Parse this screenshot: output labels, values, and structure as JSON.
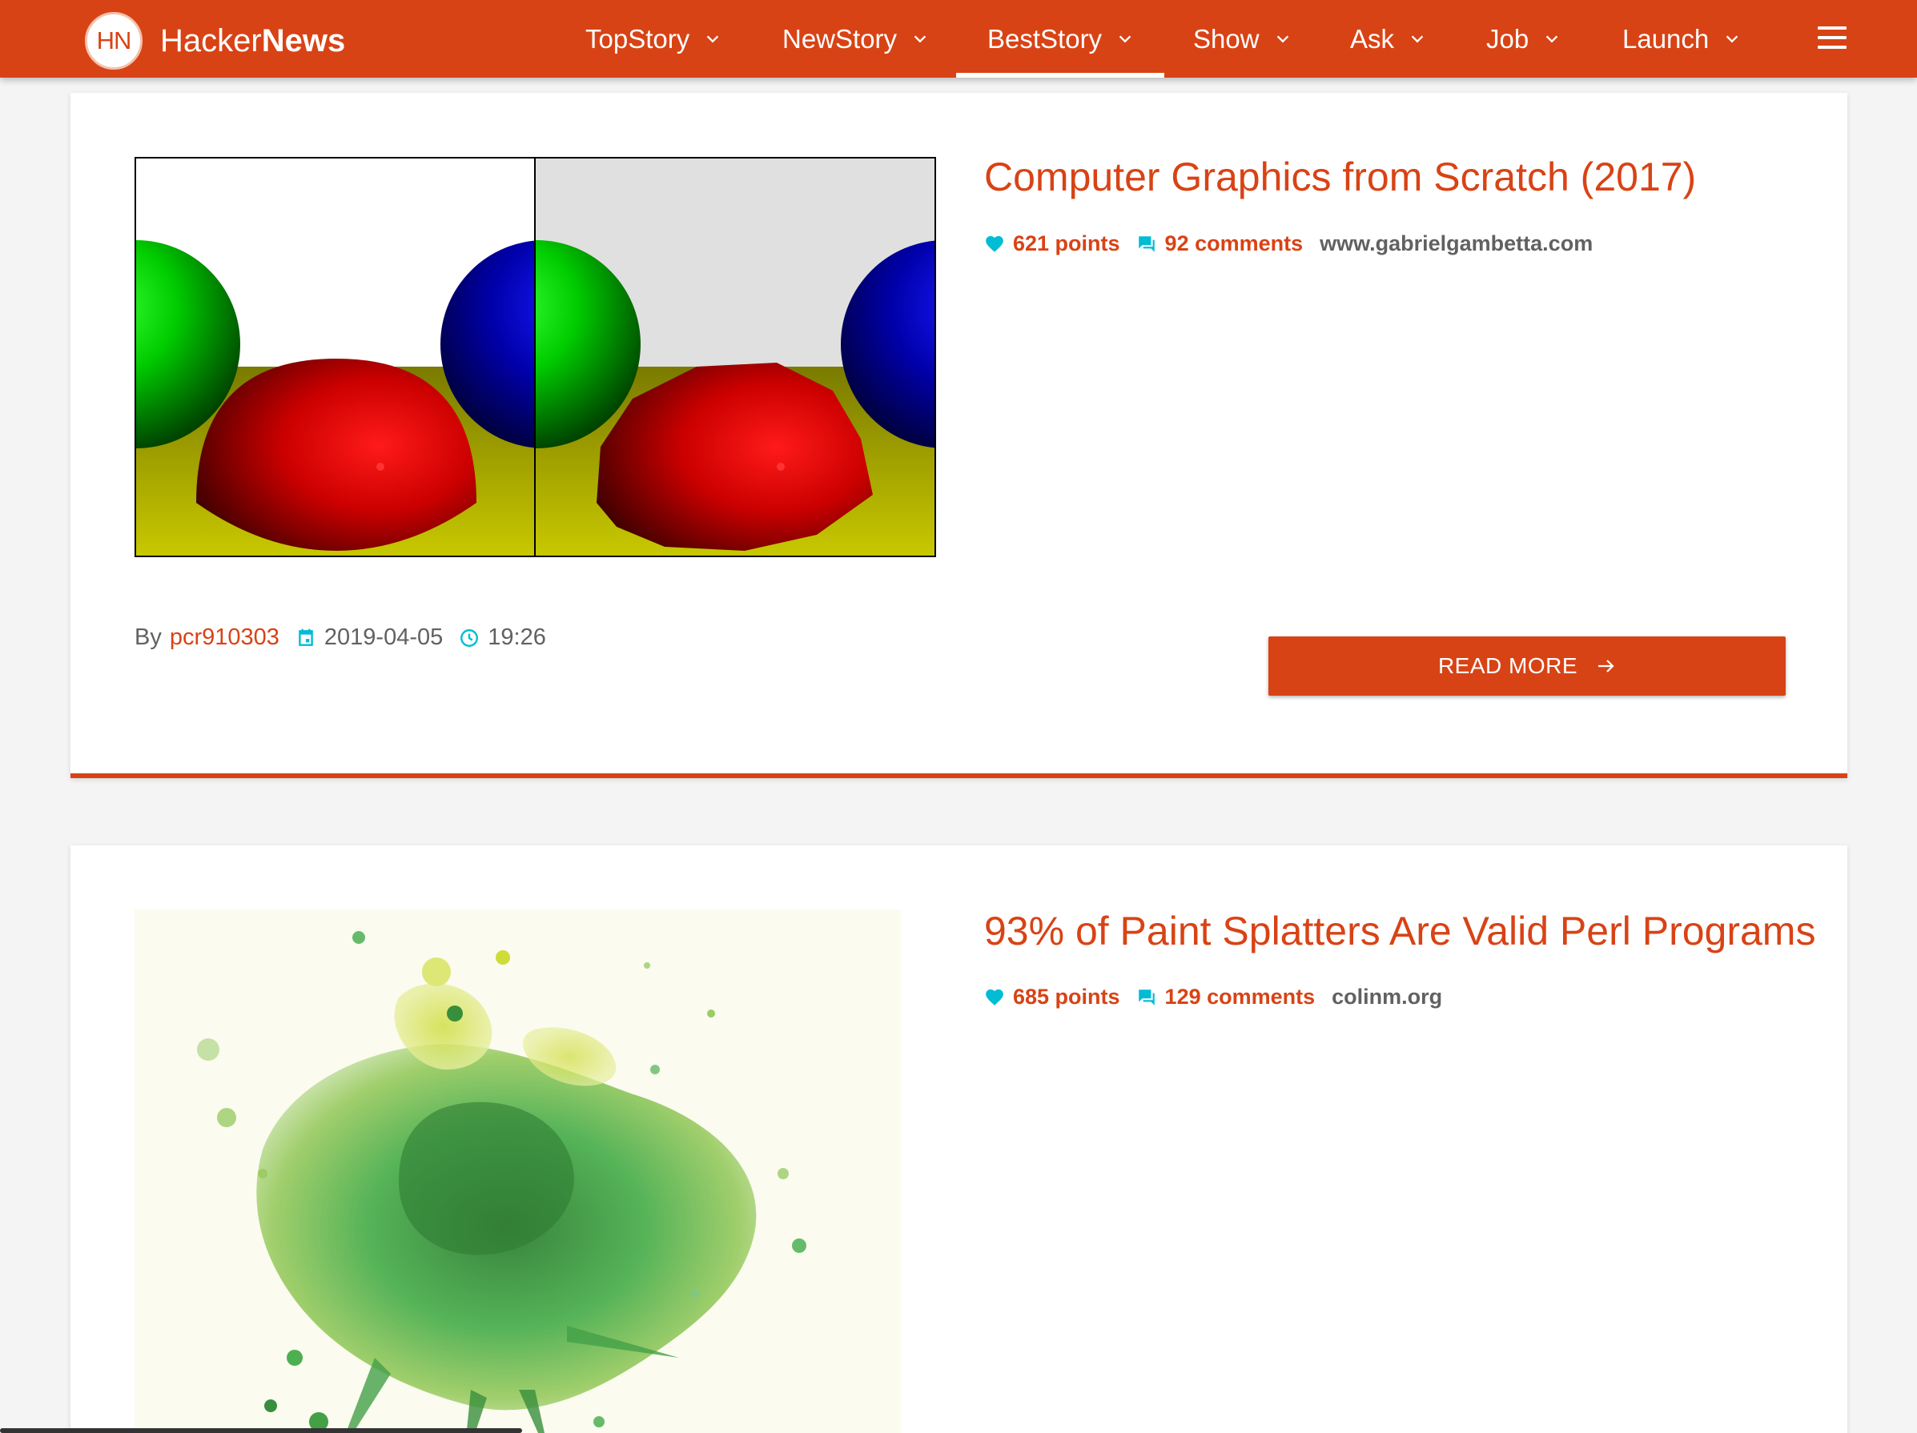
{
  "brand": {
    "logo_text": "HN",
    "name_light": "Hacker",
    "name_bold": "News"
  },
  "nav": {
    "items": [
      {
        "label": "TopStory",
        "active": false
      },
      {
        "label": "NewStory",
        "active": false
      },
      {
        "label": "BestStory",
        "active": true
      },
      {
        "label": "Show",
        "active": false
      },
      {
        "label": "Ask",
        "active": false
      },
      {
        "label": "Job",
        "active": false
      },
      {
        "label": "Launch",
        "active": false
      }
    ],
    "menu_icon": "hamburger-menu-icon"
  },
  "stories": [
    {
      "title": "Computer Graphics from Scratch (2017)",
      "points": "621 points",
      "comments": "92 comments",
      "domain": "www.gabrielgambetta.com",
      "by_label": "By",
      "author": "pcr910303",
      "date": "2019-04-05",
      "time": "19:26",
      "read_more": "READ MORE",
      "thumbnail": "raytraced-spheres-comparison"
    },
    {
      "title": "93% of Paint Splatters Are Valid Perl Programs",
      "points": "685 points",
      "comments": "129 comments",
      "domain": "colinm.org",
      "thumbnail": "green-paint-splatter"
    }
  ],
  "colors": {
    "primary": "#d84315",
    "accent": "#00bcd4",
    "text_muted": "#616161"
  }
}
